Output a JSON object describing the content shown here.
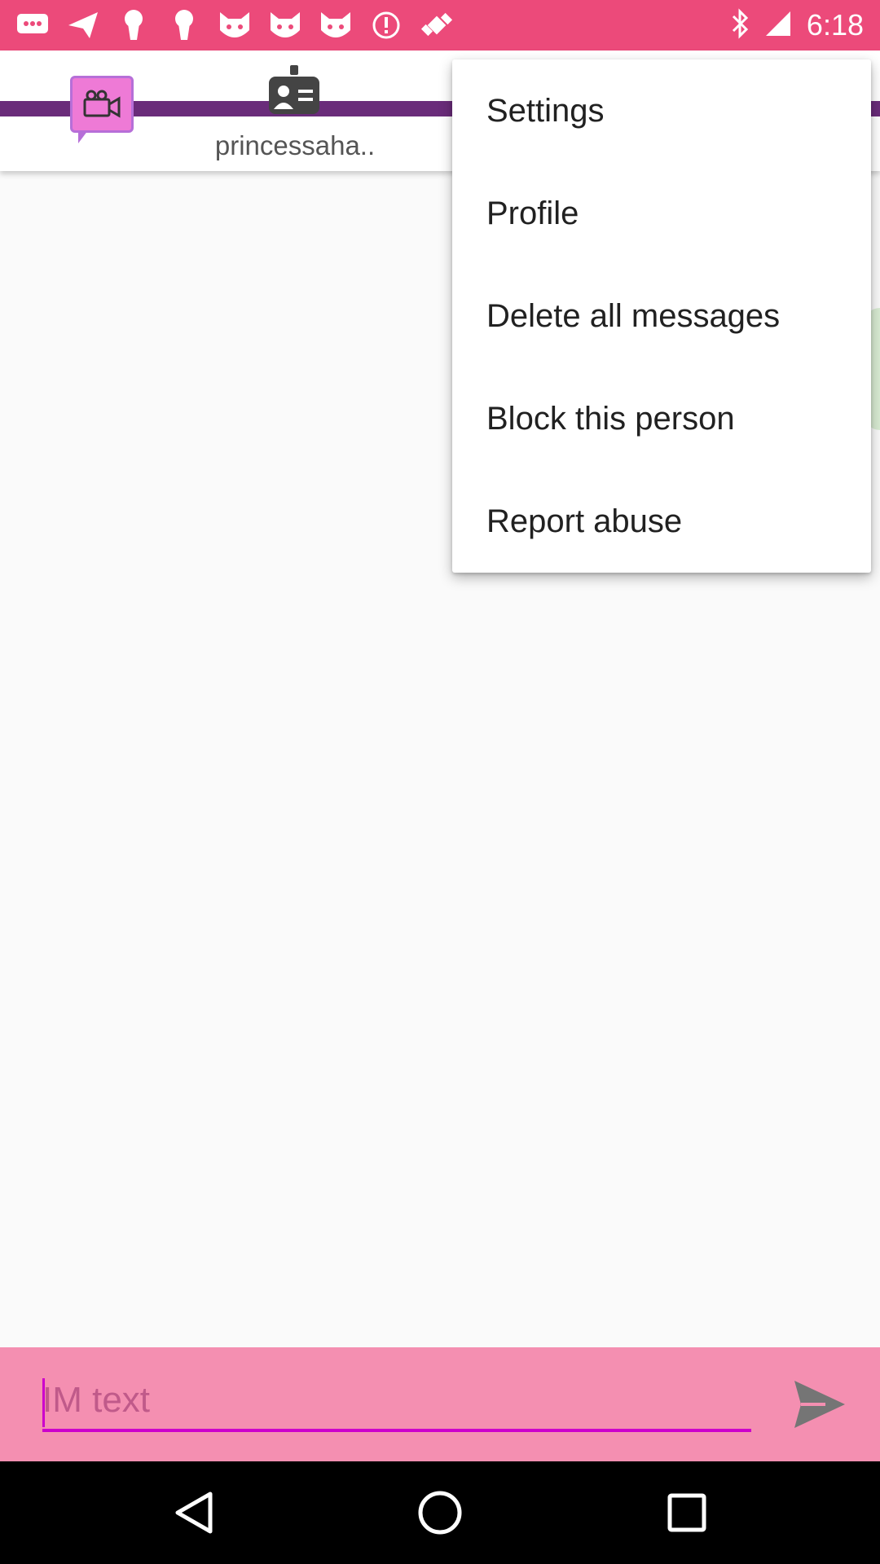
{
  "status_bar": {
    "time": "6:18",
    "icons": [
      "messages-icon",
      "send-icon",
      "keyhole-icon",
      "keyhole-icon",
      "cat-icon",
      "cat-icon",
      "cat-icon",
      "alert-icon",
      "satellite-fake-icon",
      "bluetooth-icon",
      "signal-icon"
    ]
  },
  "toolbar": {
    "video_tab_icon": "video-camera-icon",
    "profile_tab_icon": "contact-card-icon",
    "profile_tab_label": "princessaha.."
  },
  "menu": {
    "items": [
      {
        "label": "Settings"
      },
      {
        "label": "Profile"
      },
      {
        "label": "Delete all messages"
      },
      {
        "label": "Block this person"
      },
      {
        "label": "Report abuse"
      }
    ]
  },
  "input": {
    "placeholder": "IM text",
    "value": ""
  },
  "colors": {
    "status_bar": "#ec4a7a",
    "toolbar_stripe": "#6a2c7a",
    "input_bar": "#f48fb1",
    "accent_magenta": "#cc00cc"
  }
}
